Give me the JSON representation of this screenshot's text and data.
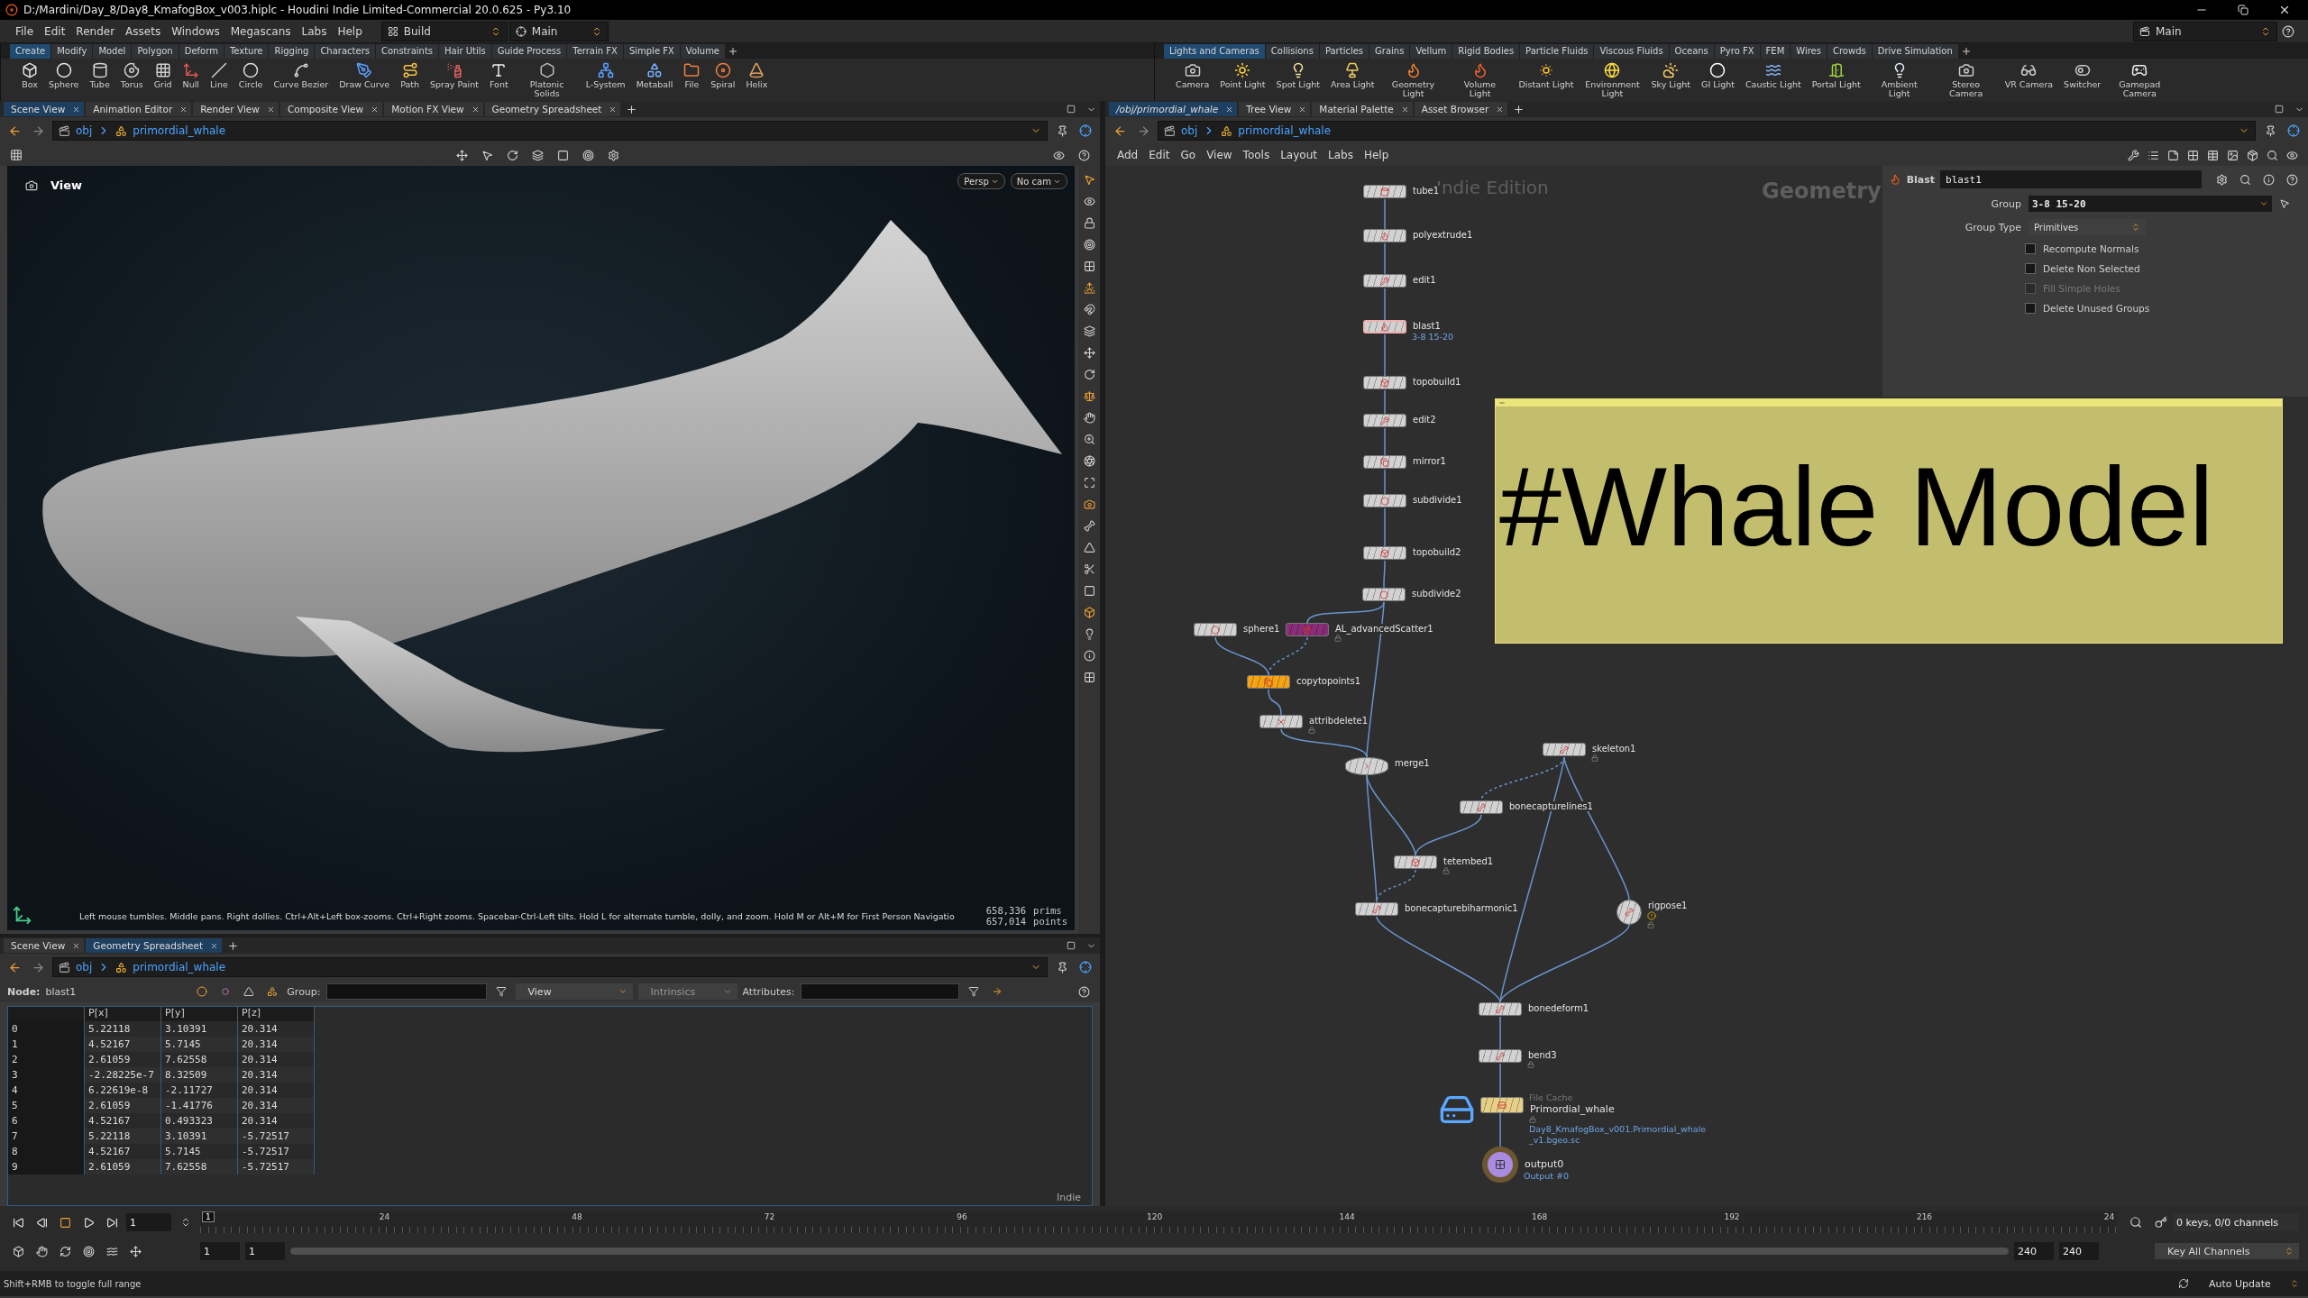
{
  "window": {
    "title": "D:/Mardini/Day_8/Day8_KmafogBox_v003.hiplc - Houdini Indie Limited-Commercial 20.0.625 - Py3.10"
  },
  "menu": [
    "File",
    "Edit",
    "Render",
    "Assets",
    "Windows",
    "Megascans",
    "Labs",
    "Help"
  ],
  "desktop": {
    "label": "Build"
  },
  "context": {
    "label": "Main"
  },
  "right_context": {
    "label": "Main"
  },
  "shelf_left": {
    "tabs": [
      {
        "label": "Create",
        "selected": true
      },
      {
        "label": "Modify",
        "selected": false
      },
      {
        "label": "Model",
        "selected": false
      },
      {
        "label": "Polygon",
        "selected": false
      },
      {
        "label": "Deform",
        "selected": false
      },
      {
        "label": "Texture",
        "selected": false
      },
      {
        "label": "Rigging",
        "selected": false
      },
      {
        "label": "Characters",
        "selected": false
      },
      {
        "label": "Constraints",
        "selected": false
      },
      {
        "label": "Hair Utils",
        "selected": false
      },
      {
        "label": "Guide Process",
        "selected": false
      },
      {
        "label": "Terrain FX",
        "selected": false
      },
      {
        "label": "Simple FX",
        "selected": false
      },
      {
        "label": "Volume",
        "selected": false
      }
    ],
    "tools": [
      "Box",
      "Sphere",
      "Tube",
      "Torus",
      "Grid",
      "Null",
      "Line",
      "Circle",
      "Curve Bezier",
      "Draw Curve",
      "Path",
      "Spray Paint",
      "Font",
      "Platonic Solids",
      "L-System",
      "Metaball",
      "File",
      "Spiral",
      "Helix"
    ]
  },
  "shelf_right": {
    "tabs": [
      {
        "label": "Lights and Cameras",
        "selected": true
      },
      {
        "label": "Collisions",
        "selected": false
      },
      {
        "label": "Particles",
        "selected": false
      },
      {
        "label": "Grains",
        "selected": false
      },
      {
        "label": "Vellum",
        "selected": false
      },
      {
        "label": "Rigid Bodies",
        "selected": false
      },
      {
        "label": "Particle Fluids",
        "selected": false
      },
      {
        "label": "Viscous Fluids",
        "selected": false
      },
      {
        "label": "Oceans",
        "selected": false
      },
      {
        "label": "Pyro FX",
        "selected": false
      },
      {
        "label": "FEM",
        "selected": false
      },
      {
        "label": "Wires",
        "selected": false
      },
      {
        "label": "Crowds",
        "selected": false
      },
      {
        "label": "Drive Simulation",
        "selected": false
      }
    ],
    "tools": [
      "Camera",
      "Point Light",
      "Spot Light",
      "Area Light",
      "Geometry Light",
      "Volume Light",
      "Distant Light",
      "Environment Light",
      "Sky Light",
      "GI Light",
      "Caustic Light",
      "Portal Light",
      "Ambient Light",
      "Stereo Camera",
      "VR Camera",
      "Switcher",
      "Gamepad Camera"
    ]
  },
  "scene_view": {
    "tabs": [
      {
        "label": "Scene View",
        "selected": true
      },
      {
        "label": "Animation Editor",
        "selected": false
      },
      {
        "label": "Render View",
        "selected": false
      },
      {
        "label": "Composite View",
        "selected": false
      },
      {
        "label": "Motion FX View",
        "selected": false
      },
      {
        "label": "Geometry Spreadsheet",
        "selected": false
      }
    ],
    "path": [
      "obj",
      "primordial_whale"
    ],
    "viewport": {
      "title": "View",
      "menus": [
        "Persp",
        "No cam"
      ],
      "hint": "Left mouse tumbles. Middle pans. Right dollies. Ctrl+Alt+Left box-zooms. Ctrl+Right zooms. Spacebar-Ctrl-Left tilts. Hold L for alternate tumble, dolly, and zoom. Hold M or Alt+M for First Person Navigatio",
      "stats": [
        {
          "value": "658,336",
          "unit": "prims"
        },
        {
          "value": "657,014",
          "unit": "points"
        }
      ]
    }
  },
  "spreadsheet": {
    "tabs": [
      {
        "label": "Scene View",
        "selected": false
      },
      {
        "label": "Geometry Spreadsheet",
        "selected": true
      }
    ],
    "path": [
      "obj",
      "primordial_whale"
    ],
    "node_label": "Node:",
    "node": "blast1",
    "group_label": "Group:",
    "view_menu": "View",
    "intrinsics_menu": "Intrinsics",
    "attributes_label": "Attributes:",
    "columns": [
      "P[x]",
      "P[y]",
      "P[z]"
    ],
    "rows": [
      {
        "index": "0",
        "cells": [
          "5.22118",
          "3.10391",
          "20.314"
        ]
      },
      {
        "index": "1",
        "cells": [
          "4.52167",
          "5.7145",
          "20.314"
        ]
      },
      {
        "index": "2",
        "cells": [
          "2.61059",
          "7.62558",
          "20.314"
        ]
      },
      {
        "index": "3",
        "cells": [
          "-2.28225e-7",
          "8.32509",
          "20.314"
        ]
      },
      {
        "index": "4",
        "cells": [
          "6.22619e-8",
          "-2.11727",
          "20.314"
        ]
      },
      {
        "index": "5",
        "cells": [
          "2.61059",
          "-1.41776",
          "20.314"
        ]
      },
      {
        "index": "6",
        "cells": [
          "4.52167",
          "0.493323",
          "20.314"
        ]
      },
      {
        "index": "7",
        "cells": [
          "5.22118",
          "3.10391",
          "-5.72517"
        ]
      },
      {
        "index": "8",
        "cells": [
          "4.52167",
          "5.7145",
          "-5.72517"
        ]
      },
      {
        "index": "9",
        "cells": [
          "2.61059",
          "7.62558",
          "-5.72517"
        ]
      }
    ],
    "badge": "Indie"
  },
  "network": {
    "tabs": [
      {
        "label": "/obj/primordial_whale",
        "selected": true
      },
      {
        "label": "Tree View",
        "selected": false
      },
      {
        "label": "Material Palette",
        "selected": false
      },
      {
        "label": "Asset Browser",
        "selected": false
      }
    ],
    "path": [
      "obj",
      "primordial_whale"
    ],
    "menu": [
      "Add",
      "Edit",
      "Go",
      "View",
      "Tools",
      "Layout",
      "Labs",
      "Help"
    ],
    "watermarks": [
      "Indie Edition",
      "Geometry"
    ],
    "nodes": [
      {
        "name": "tube1",
        "kind": "box",
        "color": "#d2d2d2",
        "selected": false,
        "locked": false
      },
      {
        "name": "polyextrude1",
        "kind": "box",
        "color": "#d2d2d2",
        "selected": false,
        "locked": false
      },
      {
        "name": "edit1",
        "kind": "box",
        "color": "#d2d2d2",
        "selected": false,
        "locked": false
      },
      {
        "name": "blast1",
        "kind": "box",
        "color": "#d2d2d2",
        "selected": true,
        "locked": false,
        "comment": "3-8 15-20"
      },
      {
        "name": "topobuild1",
        "kind": "box",
        "color": "#d2d2d2",
        "selected": false,
        "locked": false
      },
      {
        "name": "edit2",
        "kind": "box",
        "color": "#d2d2d2",
        "selected": false,
        "locked": false
      },
      {
        "name": "mirror1",
        "kind": "box",
        "color": "#d2d2d2",
        "selected": false,
        "locked": false
      },
      {
        "name": "subdivide1",
        "kind": "box",
        "color": "#d2d2d2",
        "selected": false,
        "locked": false
      },
      {
        "name": "topobuild2",
        "kind": "box",
        "color": "#d2d2d2",
        "selected": false,
        "locked": false
      },
      {
        "name": "subdivide2",
        "kind": "box",
        "color": "#d2d2d2",
        "selected": false,
        "locked": false
      },
      {
        "name": "sphere1",
        "kind": "box",
        "color": "#d2d2d2",
        "selected": false,
        "locked": false
      },
      {
        "name": "AL_advancedScatter1",
        "kind": "box",
        "color": "#8a2d78",
        "selected": false,
        "locked": true
      },
      {
        "name": "copytopoints1",
        "kind": "box",
        "color": "#f5a417",
        "selected": false,
        "locked": false
      },
      {
        "name": "attribdelete1",
        "kind": "box",
        "color": "#d2d2d2",
        "selected": false,
        "locked": true
      },
      {
        "name": "merge1",
        "kind": "merge",
        "color": "#d2d2d2",
        "selected": false,
        "locked": false
      },
      {
        "name": "skeleton1",
        "kind": "box",
        "color": "#d2d2d2",
        "selected": false,
        "locked": true
      },
      {
        "name": "bonecapturelines1",
        "kind": "box",
        "color": "#d2d2d2",
        "selected": false,
        "locked": false
      },
      {
        "name": "tetembed1",
        "kind": "box",
        "color": "#d2d2d2",
        "selected": false,
        "locked": true
      },
      {
        "name": "bonecapturebiharmonic1",
        "kind": "box",
        "color": "#d2d2d2",
        "selected": false,
        "locked": false
      },
      {
        "name": "rigpose1",
        "kind": "circle",
        "color": "#d2d2d2",
        "selected": false,
        "locked": true,
        "warning": true
      },
      {
        "name": "bonedeform1",
        "kind": "box",
        "color": "#d2d2d2",
        "selected": false,
        "locked": false
      },
      {
        "name": "bend3",
        "kind": "box",
        "color": "#d2d2d2",
        "selected": false,
        "locked": true
      },
      {
        "name": "Primordial_whale",
        "kind": "cache",
        "color": "#e6cf86",
        "selected": false,
        "locked": true,
        "type_label": "File Cache",
        "comment": "Day8_KmafogBox_v001.Primordial_whale_v1.bgeo.sc"
      },
      {
        "name": "output0",
        "kind": "output",
        "color": "#a98be0",
        "selected": false,
        "locked": false,
        "comment": "Output #0"
      }
    ],
    "sticky_note": {
      "text": "#Whale Model"
    },
    "parameters": {
      "type": "Blast",
      "name": "blast1",
      "group": {
        "label": "Group",
        "value": "3-8 15-20"
      },
      "group_type": {
        "label": "Group Type",
        "value": "Primitives"
      },
      "toggles": [
        {
          "label": "Recompute Normals",
          "checked": false,
          "disabled": false
        },
        {
          "label": "Delete Non Selected",
          "checked": false,
          "disabled": false
        },
        {
          "label": "Fill Simple Holes",
          "checked": false,
          "disabled": true
        },
        {
          "label": "Delete Unused Groups",
          "checked": false,
          "disabled": false
        }
      ]
    }
  },
  "timeline": {
    "range": {
      "level": 1
    },
    "current": "1",
    "frame": "1",
    "ticks": [
      "24",
      "48",
      "72",
      "96",
      "120",
      "144",
      "168",
      "192",
      "216",
      "24"
    ],
    "start": [
      "1",
      "1"
    ],
    "end": [
      "240",
      "240"
    ],
    "keys": "0 keys, 0/0 channels",
    "key_menu": "Key All Channels"
  },
  "status_bar": {
    "hint": "Shift+RMB to toggle full range",
    "update": "Auto Update"
  }
}
